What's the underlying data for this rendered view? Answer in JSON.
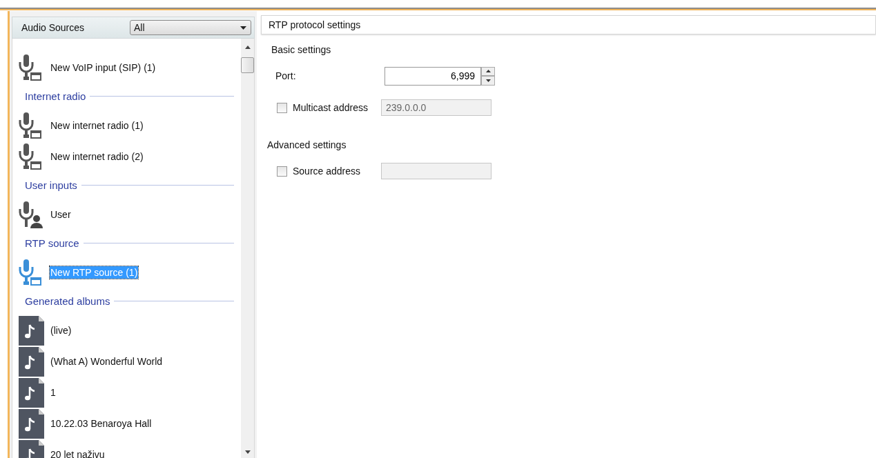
{
  "sidebar": {
    "title": "Audio Sources",
    "filter": "All",
    "groups": [
      {
        "items": [
          {
            "label": "New VoIP input (SIP) (1)",
            "kind": "mic-device",
            "selected": false
          }
        ]
      },
      {
        "heading": "Internet radio",
        "items": [
          {
            "label": "New internet radio (1)",
            "kind": "mic-device",
            "selected": false
          },
          {
            "label": "New internet radio (2)",
            "kind": "mic-device",
            "selected": false
          }
        ]
      },
      {
        "heading": "User inputs",
        "items": [
          {
            "label": "User",
            "kind": "mic-user",
            "selected": false
          }
        ]
      },
      {
        "heading": "RTP source",
        "items": [
          {
            "label": "New RTP source (1)",
            "kind": "mic-device",
            "selected": true
          }
        ]
      },
      {
        "heading": "Generated albums",
        "items": [
          {
            "label": "(live)",
            "kind": "album",
            "selected": false
          },
          {
            "label": "(What A) Wonderful World",
            "kind": "album",
            "selected": false
          },
          {
            "label": "1",
            "kind": "album",
            "selected": false
          },
          {
            "label": "10.22.03 Benaroya Hall",
            "kind": "album",
            "selected": false
          },
          {
            "label": "20 let naživu",
            "kind": "album",
            "selected": false
          }
        ]
      }
    ]
  },
  "settings": {
    "title": "RTP protocol settings",
    "sections": [
      {
        "heading": "Basic settings",
        "rows": [
          {
            "kind": "spinner",
            "label": "Port:",
            "value": "6,999"
          },
          {
            "kind": "check-field",
            "label": "Multicast address",
            "checked": false,
            "value": "239.0.0.0"
          }
        ]
      },
      {
        "heading": "Advanced settings",
        "rows": [
          {
            "kind": "check-field",
            "label": "Source address",
            "checked": false
          }
        ]
      }
    ]
  }
}
